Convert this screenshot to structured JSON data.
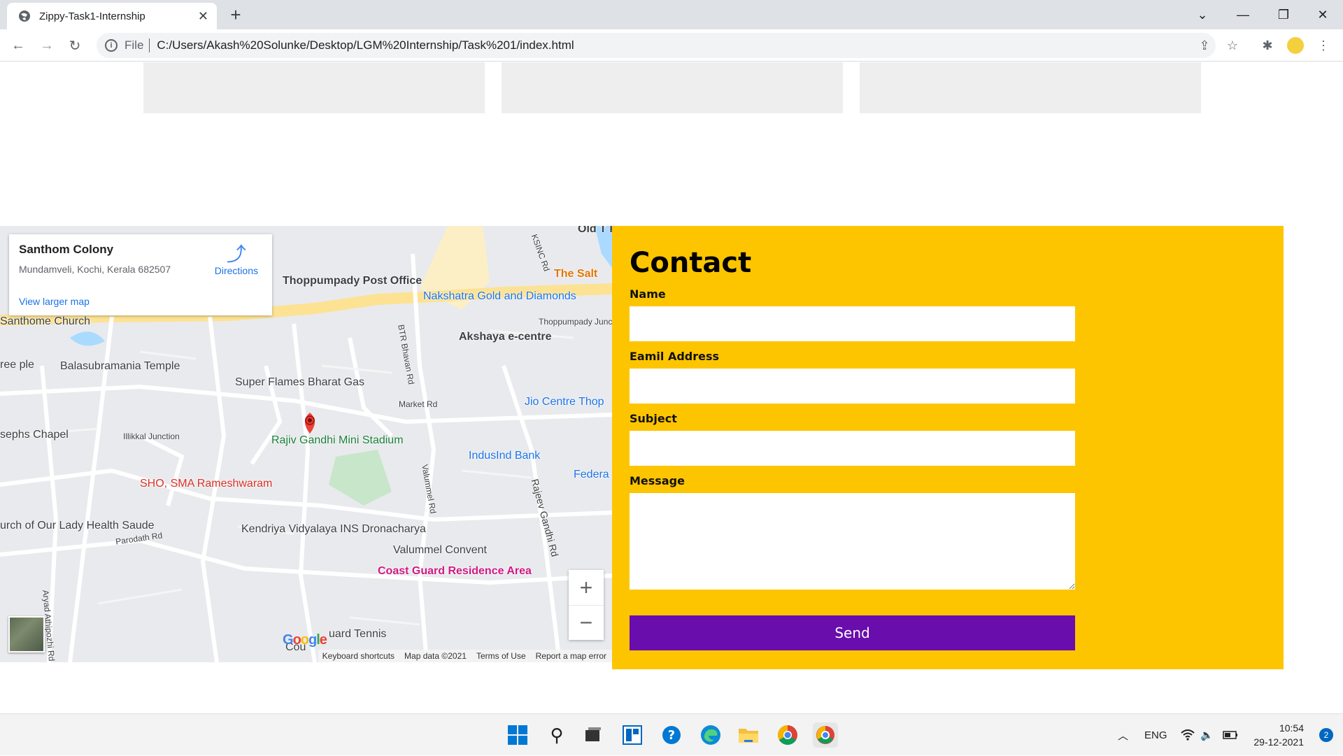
{
  "browser": {
    "tab_title": "Zippy-Task1-Internship",
    "tab_close": "✕",
    "new_tab": "+",
    "scheme": "File",
    "url": "C:/Users/Akash%20Solunke/Desktop/LGM%20Internship/Task%201/index.html",
    "win_controls": [
      "⌄",
      "—",
      "❐",
      "✕"
    ]
  },
  "map": {
    "place_name": "Santhom Colony",
    "address": "Mundamveli, Kochi, Kerala 682507",
    "directions_label": "Directions",
    "view_larger": "View larger map",
    "zoom_in": "+",
    "zoom_out": "−",
    "footer": [
      "Keyboard shortcuts",
      "Map data ©2021",
      "Terms of Use",
      "Report a map error"
    ],
    "google_logo": "Google",
    "labels": [
      "Thoppumpady Post Office",
      "Nakshatra Gold and Diamonds",
      "The Salt",
      "Thoppumpady Junction",
      "Akshaya e-centre",
      "Balasubramania Temple",
      "Super Flames Bharat Gas",
      "Market Rd",
      "Jio Centre Thop",
      "Rajiv Gandhi Mini Stadium",
      "Illikkal Junction",
      "sephs Chapel",
      "SHO, SMA Rameshwaram",
      "IndusInd Bank",
      "Federa Thoppu",
      "urch of Our Lady Health Saude",
      "Kendriya Vidyalaya INS Dronacharya",
      "Valummel Convent",
      "Coast Guard Residence Area",
      "Santhome Church",
      "BTR Bhavan Rd",
      "Valummel Rd",
      "Rajeev Gandhi Rd",
      "Parodath Rd",
      "Aryad Athipozhi Rd",
      "KSINC Rd",
      "uard Tennis",
      "Cou",
      "Old T Har",
      "ree ple"
    ]
  },
  "contact": {
    "heading": "Contact",
    "name_label": "Name",
    "email_label": "Eamil Address",
    "subject_label": "Subject",
    "message_label": "Message",
    "send_label": "Send"
  },
  "taskbar": {
    "lang": "ENG",
    "time": "10:54",
    "date": "29-12-2021",
    "notifications": "2"
  }
}
